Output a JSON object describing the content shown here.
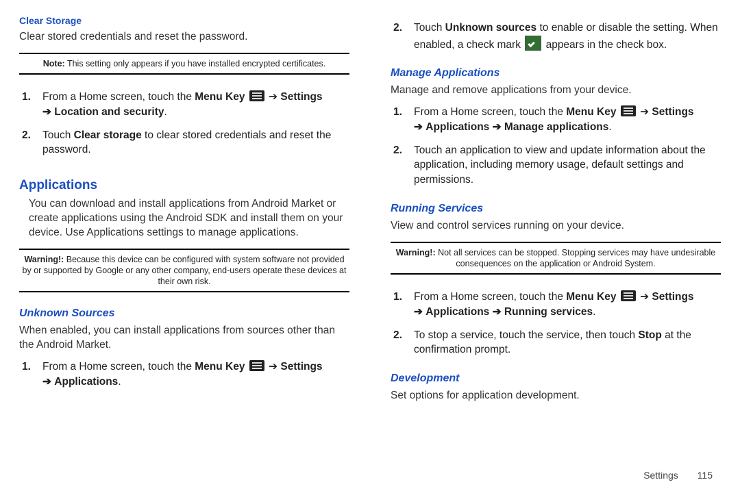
{
  "left": {
    "clearStorage": {
      "heading": "Clear Storage",
      "desc": "Clear stored credentials and reset the password.",
      "noteLead": "Note:",
      "note": " This setting only appears if you have installed encrypted certificates.",
      "step1_a": "From a Home screen, touch the ",
      "step1_menuKey": "Menu Key",
      "step1_arrow1": " ➔ ",
      "step1_settings": "Settings",
      "step1_arrow2": "➔ ",
      "step1_loc": "Location and security",
      "step1_dot": ".",
      "step2_a": "Touch ",
      "step2_b": "Clear storage",
      "step2_c": " to clear stored credentials and reset the password."
    },
    "apps": {
      "heading": "Applications",
      "desc": "You can download and install applications from Android Market or create applications using the Android SDK and install them on your device. Use Applications settings to manage applications.",
      "warnLead": "Warning!:",
      "warn": " Because this device can be configured with system software not provided by or supported by Google or any other company, end-users operate these devices at their own risk."
    },
    "unknown": {
      "heading": "Unknown Sources",
      "desc": "When enabled, you can install applications from sources other than the Android Market.",
      "step1_a": "From a Home screen, touch the ",
      "step1_menuKey": "Menu Key",
      "step1_arrow1": " ➔ ",
      "step1_settings": "Settings",
      "step1_arrow2": "➔ ",
      "step1_apps": "Applications",
      "step1_dot": "."
    }
  },
  "right": {
    "step2_a": "Touch ",
    "step2_b": "Unknown sources",
    "step2_c": " to enable or disable the setting. When enabled, a check mark ",
    "step2_d": " appears in the check box.",
    "manage": {
      "heading": "Manage Applications",
      "desc": "Manage and remove applications from your device.",
      "step1_a": "From a Home screen, touch the ",
      "step1_menuKey": "Menu Key",
      "step1_arrow1": " ➔ ",
      "step1_settings": "Settings",
      "step1_arrow2": "➔ ",
      "step1_apps": "Applications",
      "step1_arrow3": " ➔ ",
      "step1_manage": "Manage applications",
      "step1_dot": ".",
      "step2": "Touch an application to view and update information about the application, including memory usage, default settings and permissions."
    },
    "running": {
      "heading": "Running Services",
      "desc": "View and control services running on your device.",
      "warnLead": "Warning!:",
      "warn": " Not all services can be stopped. Stopping services may have undesirable consequences on the application or Android System.",
      "step1_a": "From a Home screen, touch the ",
      "step1_menuKey": "Menu Key",
      "step1_arrow1": " ➔ ",
      "step1_settings": "Settings",
      "step1_arrow2": "➔ ",
      "step1_apps": "Applications",
      "step1_arrow3": " ➔ ",
      "step1_run": "Running services",
      "step1_dot": ".",
      "step2_a": "To stop a service, touch the service, then touch ",
      "step2_b": "Stop",
      "step2_c": " at the confirmation prompt."
    },
    "dev": {
      "heading": "Development",
      "desc": "Set options for application development."
    }
  },
  "footer": {
    "section": "Settings",
    "page": "115"
  }
}
